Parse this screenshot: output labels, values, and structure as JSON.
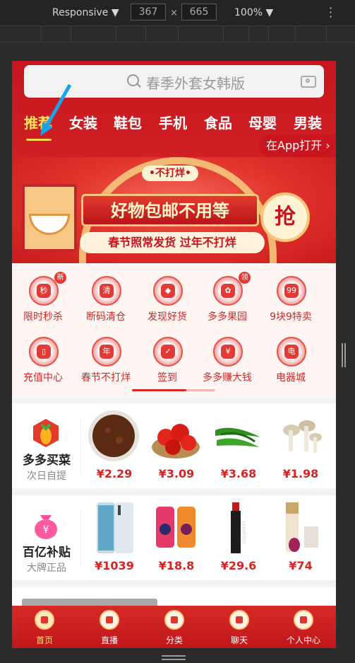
{
  "devtools": {
    "device_mode": "Responsive ▼",
    "width": "367",
    "height": "665",
    "times": "×",
    "zoom": "100% ▼"
  },
  "search": {
    "placeholder": "春季外套女韩版"
  },
  "categories": [
    "推荐",
    "女装",
    "鞋包",
    "手机",
    "食品",
    "母婴",
    "男装"
  ],
  "open_app": "在App打开 ›",
  "banner": {
    "badge": "•不打烊•",
    "headline": "好物包邮不用等",
    "subline": "春节照常发货 过年不打烊",
    "grab": "抢"
  },
  "icons": [
    {
      "label": "限时秒杀",
      "glyph": "秒",
      "tag": "新"
    },
    {
      "label": "断码清仓",
      "glyph": "清",
      "tag": ""
    },
    {
      "label": "发现好货",
      "glyph": "◆",
      "tag": ""
    },
    {
      "label": "多多果园",
      "glyph": "✿",
      "tag": "领"
    },
    {
      "label": "9块9特卖",
      "glyph": "99",
      "tag": ""
    },
    {
      "label": "充值中心",
      "glyph": "▯",
      "tag": ""
    },
    {
      "label": "春节不打烊",
      "glyph": "年",
      "tag": ""
    },
    {
      "label": "签到",
      "glyph": "✓",
      "tag": ""
    },
    {
      "label": "多多赚大钱",
      "glyph": "¥",
      "tag": ""
    },
    {
      "label": "电器城",
      "glyph": "电",
      "tag": ""
    }
  ],
  "icons_scroll_fraction": 0.65,
  "grocery": {
    "title": "多多买菜",
    "subtitle": "次日自提",
    "products": [
      {
        "name": "sauce",
        "price": "¥2.29"
      },
      {
        "name": "tomatoes",
        "price": "¥3.09"
      },
      {
        "name": "green-peppers",
        "price": "¥3.68"
      },
      {
        "name": "mushrooms",
        "price": "¥1.98"
      }
    ]
  },
  "subsidy": {
    "title": "百亿补贴",
    "subtitle": "大牌正品",
    "products": [
      {
        "name": "phone",
        "price": "¥1039"
      },
      {
        "name": "phone-cases",
        "price": "¥18.8"
      },
      {
        "name": "lipstick",
        "price": "¥29.6"
      },
      {
        "name": "foundation",
        "price": "¥74"
      }
    ]
  },
  "tabbar": [
    {
      "label": "首页",
      "active": true
    },
    {
      "label": "直播",
      "active": false
    },
    {
      "label": "分类",
      "active": false
    },
    {
      "label": "聊天",
      "active": false
    },
    {
      "label": "个人中心",
      "active": false
    }
  ],
  "colors": {
    "brand": "#d72a26",
    "price": "#d72323",
    "accent_yellow": "#ffe45c"
  }
}
